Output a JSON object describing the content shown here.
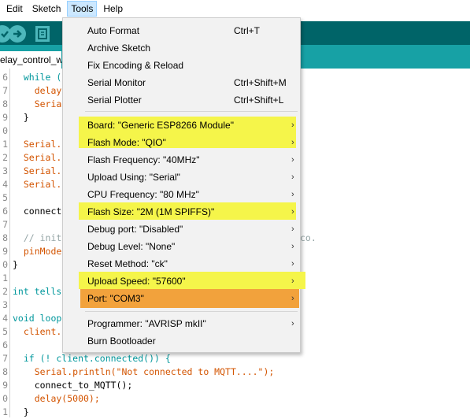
{
  "menubar": {
    "items": [
      {
        "label": "Edit"
      },
      {
        "label": "Sketch"
      },
      {
        "label": "Tools"
      },
      {
        "label": "Help"
      }
    ]
  },
  "tab": {
    "label": "elay_control_w"
  },
  "editor": {
    "lines": [
      {
        "num": "6",
        "text": "  while ("
      },
      {
        "num": "7",
        "text": "    delay"
      },
      {
        "num": "8",
        "text": "    Seria"
      },
      {
        "num": "9",
        "text": "  }"
      },
      {
        "num": "0",
        "text": ""
      },
      {
        "num": "1",
        "text": "  Serial."
      },
      {
        "num": "2",
        "text": "  Serial."
      },
      {
        "num": "3",
        "text": "  Serial."
      },
      {
        "num": "4",
        "text": "  Serial."
      },
      {
        "num": "5",
        "text": ""
      },
      {
        "num": "6",
        "text": "  connect"
      },
      {
        "num": "7",
        "text": ""
      },
      {
        "num": "8",
        "text": "  // init"
      },
      {
        "num": "9",
        "text": "  pinMode"
      },
      {
        "num": "0",
        "text": "}"
      },
      {
        "num": "1",
        "text": ""
      },
      {
        "num": "2",
        "text": "int tells"
      },
      {
        "num": "3",
        "text": ""
      },
      {
        "num": "4",
        "text": "void loop"
      },
      {
        "num": "5",
        "text": "  client."
      },
      {
        "num": "6",
        "text": ""
      },
      {
        "num": "7",
        "text": "  if (! client.connected()) {"
      },
      {
        "num": "8",
        "text": "    Serial.println(\"Not connected to MQTT....\");"
      },
      {
        "num": "9",
        "text": "    connect_to_MQTT();"
      },
      {
        "num": "0",
        "text": "    delay(5000);"
      },
      {
        "num": "1",
        "text": "  }"
      }
    ],
    "overflow_text": "co."
  },
  "tools_menu": {
    "items": [
      {
        "label": "Auto Format",
        "shortcut": "Ctrl+T",
        "submenu": false,
        "highlight": ""
      },
      {
        "label": "Archive Sketch",
        "shortcut": "",
        "submenu": false,
        "highlight": ""
      },
      {
        "label": "Fix Encoding & Reload",
        "shortcut": "",
        "submenu": false,
        "highlight": ""
      },
      {
        "label": "Serial Monitor",
        "shortcut": "Ctrl+Shift+M",
        "submenu": false,
        "highlight": ""
      },
      {
        "label": "Serial Plotter",
        "shortcut": "Ctrl+Shift+L",
        "submenu": false,
        "highlight": ""
      },
      {
        "label": "Board: \"Generic ESP8266 Module\"",
        "shortcut": "",
        "submenu": true,
        "highlight": "yellow"
      },
      {
        "label": "Flash Mode: \"QIO\"",
        "shortcut": "",
        "submenu": true,
        "highlight": "yellow"
      },
      {
        "label": "Flash Frequency: \"40MHz\"",
        "shortcut": "",
        "submenu": true,
        "highlight": ""
      },
      {
        "label": "Upload Using: \"Serial\"",
        "shortcut": "",
        "submenu": true,
        "highlight": ""
      },
      {
        "label": "CPU Frequency: \"80 MHz\"",
        "shortcut": "",
        "submenu": true,
        "highlight": ""
      },
      {
        "label": "Flash Size: \"2M (1M SPIFFS)\"",
        "shortcut": "",
        "submenu": true,
        "highlight": "yellow"
      },
      {
        "label": "Debug port: \"Disabled\"",
        "shortcut": "",
        "submenu": true,
        "highlight": ""
      },
      {
        "label": "Debug Level: \"None\"",
        "shortcut": "",
        "submenu": true,
        "highlight": ""
      },
      {
        "label": "Reset Method: \"ck\"",
        "shortcut": "",
        "submenu": true,
        "highlight": ""
      },
      {
        "label": "Upload Speed: \"57600\"",
        "shortcut": "",
        "submenu": true,
        "highlight": "yellow"
      },
      {
        "label": "Port: \"COM3\"",
        "shortcut": "",
        "submenu": true,
        "highlight": "orange"
      },
      {
        "label": "Programmer: \"AVRISP mkII\"",
        "shortcut": "",
        "submenu": true,
        "highlight": ""
      },
      {
        "label": "Burn Bootloader",
        "shortcut": "",
        "submenu": false,
        "highlight": ""
      }
    ]
  },
  "colors": {
    "toolbar": "#006468",
    "tabbar": "#17a1a5",
    "highlight_yellow": "#f5f54a",
    "highlight_orange": "#f2a23c",
    "menu_bg": "#f2f2f2"
  }
}
